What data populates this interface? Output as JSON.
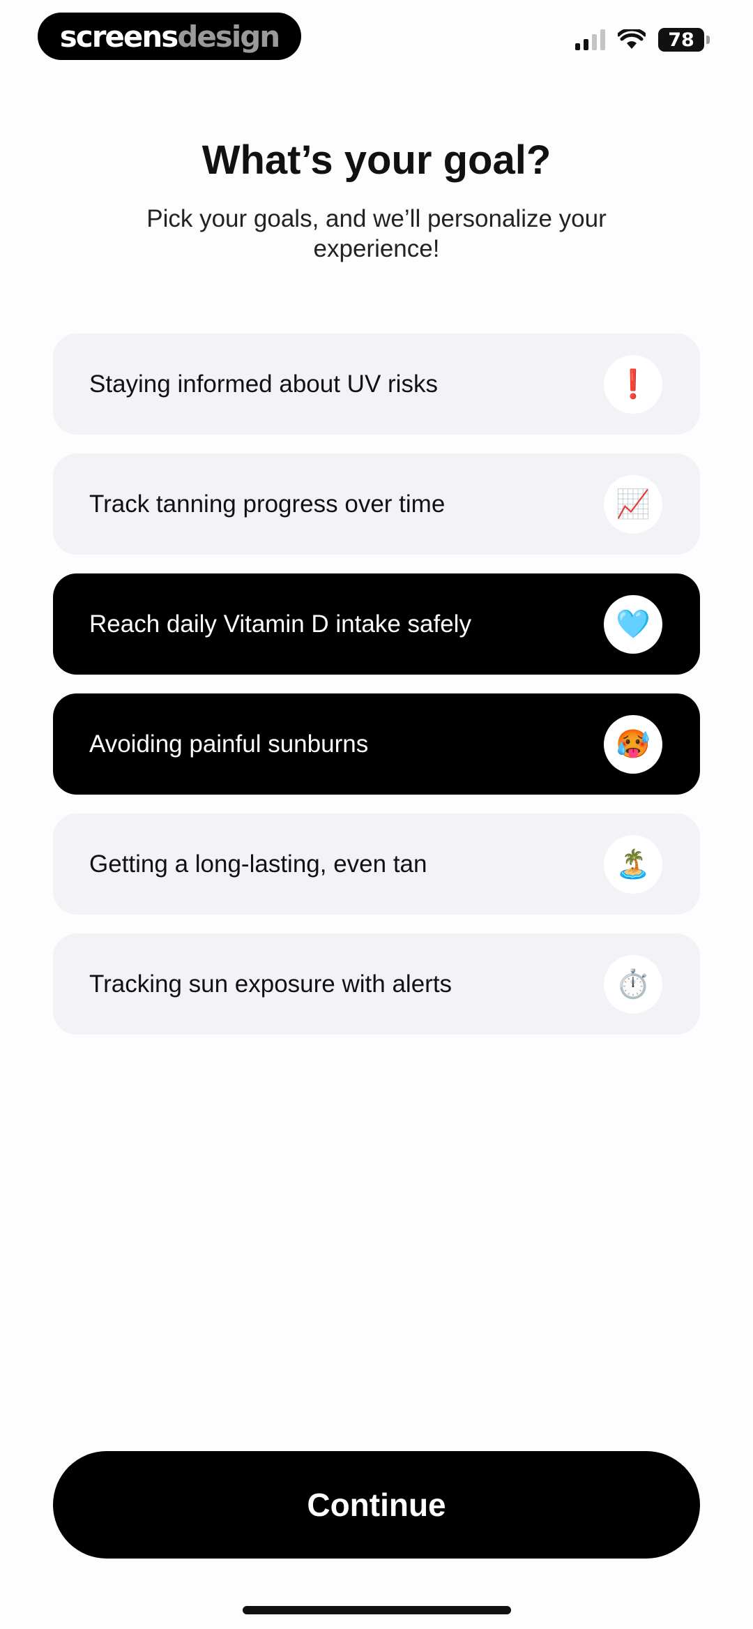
{
  "watermark": {
    "part1": "screens",
    "part2": "design"
  },
  "status_bar": {
    "battery": "78",
    "signal_bars_active": 2,
    "signal_bars_total": 4
  },
  "header": {
    "title": "What’s your goal?",
    "subtitle": "Pick your goals, and we’ll personalize your experience!"
  },
  "options": [
    {
      "label": "Staying informed about UV risks",
      "emoji": "❗",
      "icon": "exclamation-icon",
      "selected": false
    },
    {
      "label": "Track tanning progress over time",
      "emoji": "📈",
      "icon": "chart-increasing-icon",
      "selected": false
    },
    {
      "label": "Reach daily Vitamin D intake safely",
      "emoji": "🩵",
      "icon": "light-blue-heart-icon",
      "selected": true
    },
    {
      "label": "Avoiding painful sunburns",
      "emoji": "🥵",
      "icon": "hot-face-icon",
      "selected": true
    },
    {
      "label": "Getting a long-lasting, even tan",
      "emoji": "🏝️",
      "icon": "beach-umbrella-icon",
      "selected": false
    },
    {
      "label": "Tracking sun exposure with alerts",
      "emoji": "⏱️",
      "icon": "stopwatch-icon",
      "selected": false
    }
  ],
  "continue_label": "Continue",
  "colors": {
    "selected_bg": "#000000",
    "unselected_bg": "#f2f2f7",
    "accent": "#000000"
  }
}
